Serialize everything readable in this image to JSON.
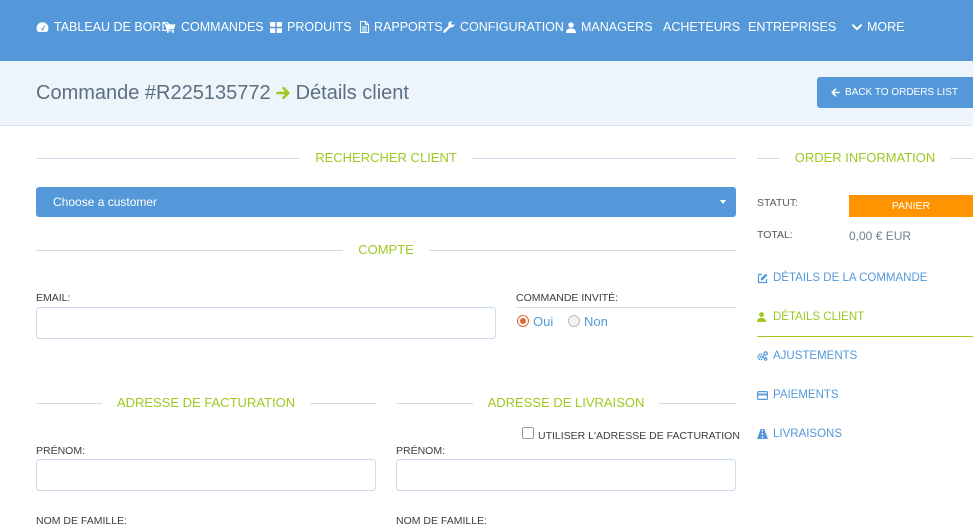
{
  "colors": {
    "brand_blue": "#5498da",
    "accent_green": "#9fc820",
    "status_orange": "#ff9300",
    "title_gray": "#5c6f82",
    "header_bg": "#eef4fb",
    "radio_checked": "#e0673a"
  },
  "nav": {
    "items": [
      {
        "label": "TABLEAU DE BORD",
        "icon": "dashboard-icon"
      },
      {
        "label": "COMMANDES",
        "icon": "cart-icon"
      },
      {
        "label": "PRODUITS",
        "icon": "grid-icon"
      },
      {
        "label": "RAPPORTS",
        "icon": "file-icon"
      },
      {
        "label": "CONFIGURATION",
        "icon": "wrench-icon"
      },
      {
        "label": "MANAGERS",
        "icon": "user-icon"
      },
      {
        "label": "ACHETEURS"
      },
      {
        "label": "ENTREPRISES"
      },
      {
        "label": "MORE",
        "icon": "chevron-down-icon"
      }
    ]
  },
  "header": {
    "title_prefix": "Commande #R225135772",
    "title_arrow_icon": "arrow-right-icon",
    "title_suffix": "Détails client",
    "back_button_label": "BACK TO ORDERS LIST",
    "back_button_icon": "arrow-left-icon"
  },
  "customer_search": {
    "heading": "RECHERCHER CLIENT",
    "select_value": "Choose a customer",
    "select_icon": "caret-down-icon"
  },
  "account": {
    "heading": "COMPTE",
    "email_label": "EMAIL:",
    "email_value": "",
    "guest_label": "COMMANDE INVITÉ:",
    "guest_options": [
      {
        "label": "Oui",
        "checked": true
      },
      {
        "label": "Non",
        "checked": false
      }
    ]
  },
  "billing": {
    "heading": "ADRESSE DE FACTURATION",
    "first_name_label": "PRÉNOM:",
    "first_name_value": "",
    "last_name_label": "NOM DE FAMILLE:"
  },
  "shipping": {
    "heading": "ADRESSE DE LIVRAISON",
    "use_billing_label": "UTILISER L'ADRESSE DE FACTURATION",
    "use_billing_checked": false,
    "first_name_label": "PRÉNOM:",
    "first_name_value": "",
    "last_name_label": "NOM DE FAMILLE:"
  },
  "order_info": {
    "heading": "ORDER INFORMATION",
    "status_label": "STATUT:",
    "status_value": "PANIER",
    "total_label": "TOTAL:",
    "total_value": "0,00 € EUR",
    "tabs": [
      {
        "label": "DÉTAILS DE LA COMMANDE",
        "icon": "edit-icon",
        "active": false
      },
      {
        "label": "DÉTAILS CLIENT",
        "icon": "user-icon",
        "active": true
      },
      {
        "label": "AJUSTEMENTS",
        "icon": "cogs-icon",
        "active": false
      },
      {
        "label": "PAIEMENTS",
        "icon": "credit-card-icon",
        "active": false
      },
      {
        "label": "LIVRAISONS",
        "icon": "road-icon",
        "active": false
      }
    ]
  }
}
